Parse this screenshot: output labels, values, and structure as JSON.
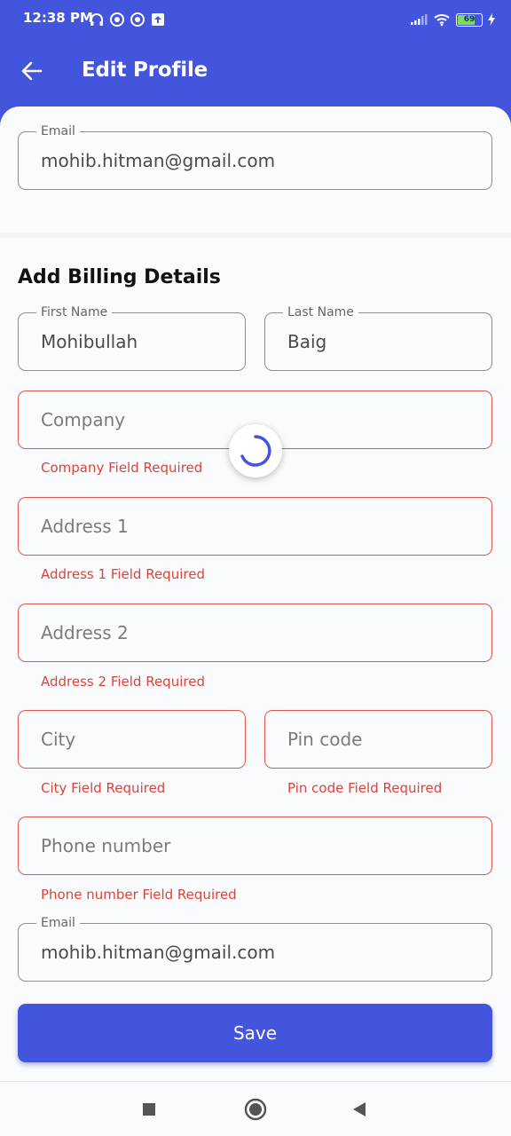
{
  "status_bar": {
    "time": "12:38 PM",
    "battery": "69",
    "icons_left": [
      "headphones-icon",
      "vpn-icon",
      "vpn-icon",
      "upload-icon"
    ],
    "icons_right": [
      "signal-icon",
      "wifi-icon",
      "battery-icon",
      "charging-icon"
    ]
  },
  "header": {
    "title": "Edit Profile",
    "back_icon": "arrow-left-icon"
  },
  "account": {
    "email_label": "Email",
    "email_value": "mohib.hitman@gmail.com"
  },
  "billing": {
    "heading": "Add Billing Details",
    "first_name": {
      "label": "First Name",
      "value": "Mohibullah"
    },
    "last_name": {
      "label": "Last Name",
      "value": "Baig"
    },
    "company": {
      "placeholder": "Company",
      "error": "Company Field Required"
    },
    "address1": {
      "placeholder": "Address 1",
      "error": "Address 1 Field Required"
    },
    "address2": {
      "placeholder": "Address 2",
      "error": "Address 2 Field Required"
    },
    "city": {
      "placeholder": "City",
      "error": "City Field Required"
    },
    "pincode": {
      "placeholder": "Pin code",
      "error": "Pin code Field Required"
    },
    "phone": {
      "placeholder": "Phone number",
      "error": "Phone number Field Required"
    },
    "email": {
      "label": "Email",
      "value": "mohib.hitman@gmail.com"
    }
  },
  "actions": {
    "save_label": "Save"
  },
  "colors": {
    "primary": "#4355dc",
    "error": "#e0574a",
    "background": "#fafbfd"
  },
  "navigation": {
    "items": [
      "recents-square-icon",
      "home-circle-icon",
      "back-triangle-icon"
    ]
  }
}
